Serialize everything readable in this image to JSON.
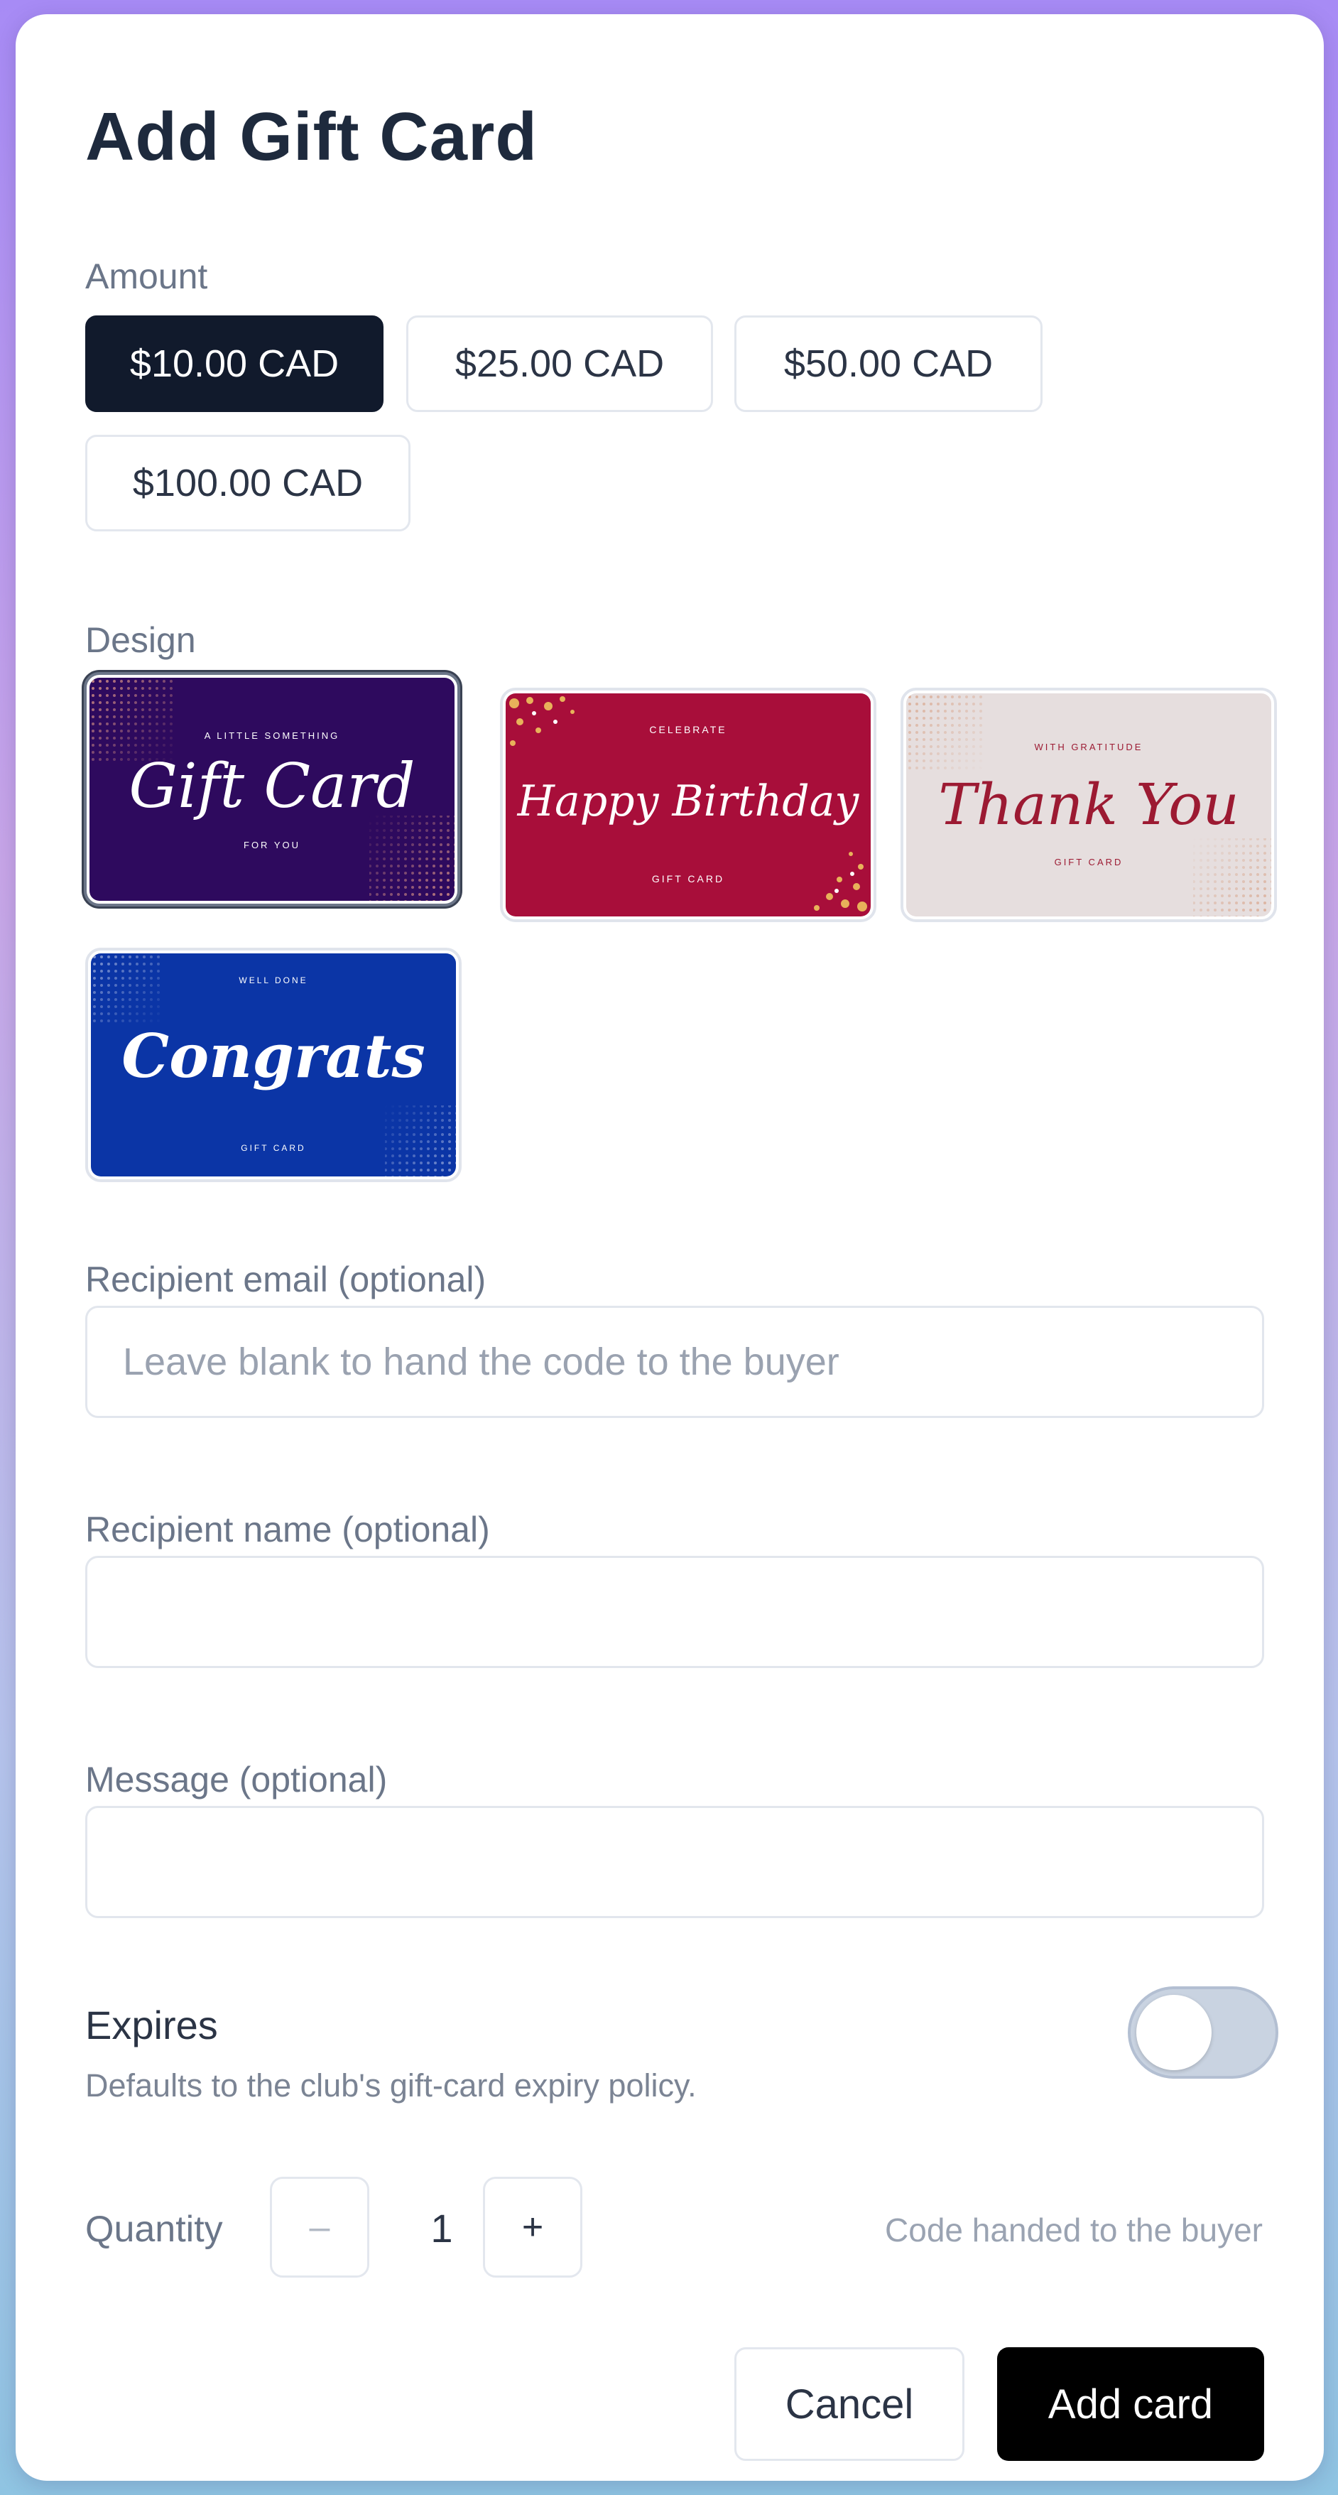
{
  "modal": {
    "title": "Add Gift Card"
  },
  "amount": {
    "label": "Amount",
    "options": [
      "$10.00 CAD",
      "$25.00 CAD",
      "$50.00 CAD",
      "$100.00 CAD"
    ],
    "selected": "$10.00 CAD"
  },
  "design": {
    "label": "Design",
    "cards": [
      {
        "top": "A LITTLE SOMETHING",
        "script": "Gift Card",
        "bottom": "FOR YOU",
        "bg": "#2e0a5e",
        "fg": "#ffffff",
        "accent": "#e8a08a"
      },
      {
        "top": "CELEBRATE",
        "script": "Happy Birthday",
        "bottom": "GIFT CARD",
        "bg": "#a80e3a",
        "fg": "#ffffff",
        "accent": "#e8b25a"
      },
      {
        "top": "WITH GRATITUDE",
        "script": "Thank You",
        "bottom": "GIFT CARD",
        "bg": "#e6dede",
        "fg": "#9c1a32",
        "accent": "#d8a48a"
      },
      {
        "top": "WELL DONE",
        "script": "Congrats",
        "bottom": "GIFT CARD",
        "bg": "#0b35a6",
        "fg": "#ffffff",
        "accent": "#d0d8f0"
      }
    ],
    "selected_index": 0
  },
  "recipient_email": {
    "label": "Recipient email (optional)",
    "value": "",
    "placeholder": "Leave blank to hand the code to the buyer"
  },
  "recipient_name": {
    "label": "Recipient name (optional)",
    "value": ""
  },
  "message": {
    "label": "Message (optional)",
    "value": ""
  },
  "expires": {
    "label": "Expires",
    "hint": "Defaults to the club's gift-card expiry policy.",
    "enabled": false
  },
  "quantity": {
    "label": "Quantity",
    "value": "1",
    "decrement": "–",
    "increment": "+",
    "note": "Code handed to the buyer"
  },
  "actions": {
    "cancel": "Cancel",
    "add": "Add card"
  },
  "colors": {
    "primary": "#000000",
    "selected_amount": "#111a2c",
    "toggle_off": "#c9d3e1"
  }
}
